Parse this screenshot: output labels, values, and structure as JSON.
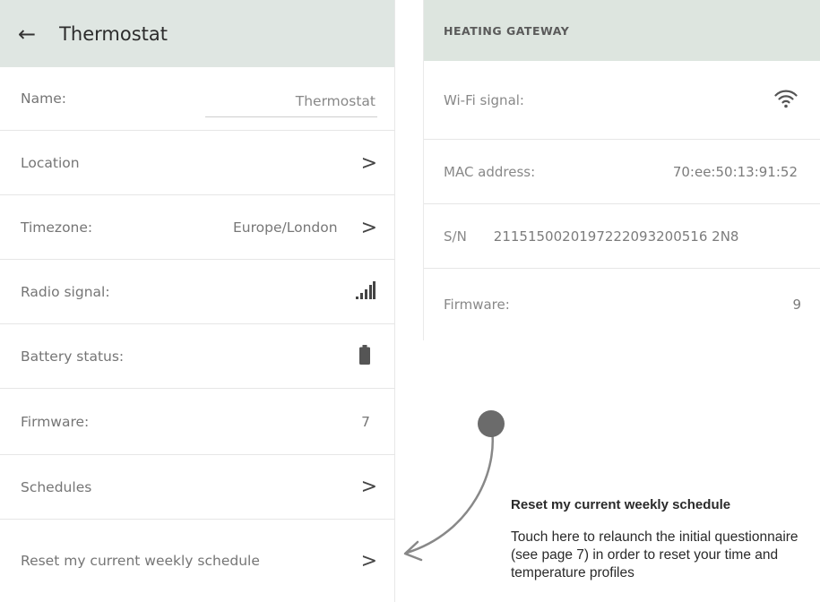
{
  "thermostat": {
    "title": "Thermostat",
    "rows": {
      "name": {
        "label": "Name:",
        "value": "Thermostat"
      },
      "location": {
        "label": "Location"
      },
      "timezone": {
        "label": "Timezone:",
        "value": "Europe/London"
      },
      "radio": {
        "label": "Radio signal:"
      },
      "battery": {
        "label": "Battery status:"
      },
      "firmware": {
        "label": "Firmware:",
        "value": "7"
      },
      "schedules": {
        "label": "Schedules"
      },
      "reset": {
        "label": "Reset my current weekly schedule"
      }
    }
  },
  "gateway": {
    "title": "HEATING GATEWAY",
    "rows": {
      "wifi": {
        "label": "Wi-Fi signal:"
      },
      "mac": {
        "label": "MAC address:",
        "value": "70:ee:50:13:91:52"
      },
      "sn": {
        "label": "S/N",
        "value": "2115150020197222093200516 2N8"
      },
      "firmware": {
        "label": "Firmware:",
        "value": "9"
      }
    }
  },
  "annotation": {
    "title": "Reset my current weekly schedule",
    "body": "Touch here to relaunch the initial questionnaire (see page 7) in order to reset your time and temperature profiles"
  },
  "icons": {
    "back": "back-arrow-icon",
    "chevron": "chevron-right-icon",
    "radio": "radio-signal-bars-icon",
    "battery": "battery-icon",
    "wifi": "wifi-icon"
  },
  "colors": {
    "header_bg": "#dfe6e2",
    "annotation_dot": "#6b6b6b"
  }
}
